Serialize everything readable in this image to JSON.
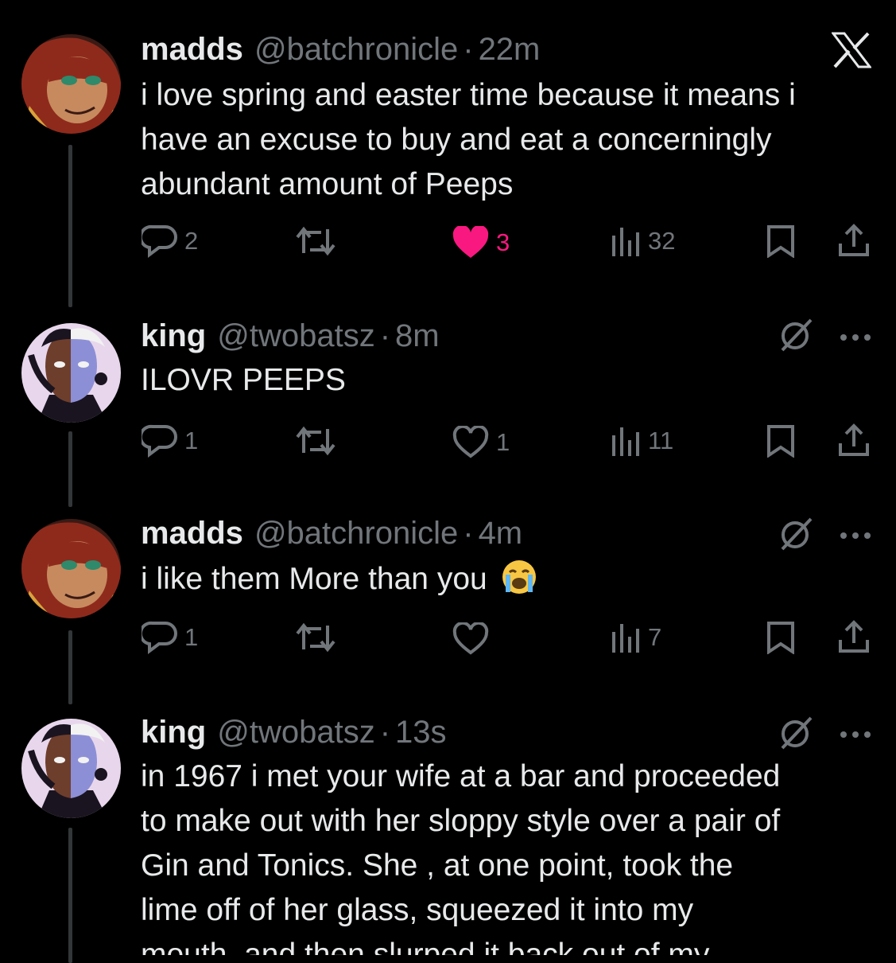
{
  "brand_logo": "X",
  "colors": {
    "background": "#000000",
    "text": "#e7e9ea",
    "muted": "#71767b",
    "like": "#f91880",
    "thread_line": "#333639"
  },
  "tweets": [
    {
      "name": "madds",
      "handle": "@batchronicle",
      "dot": "·",
      "time": "22m",
      "text_lines": [
        "i love spring and easter time because it means i",
        "have an excuse to buy and eat a concerningly",
        "abundant amount of Peeps"
      ],
      "replies": "2",
      "retweets": "",
      "likes": "3",
      "liked": true,
      "views": "32",
      "top_right_icon": "x-logo-icon"
    },
    {
      "name": "king",
      "handle": "@twobatsz",
      "dot": "·",
      "time": "8m",
      "text_lines": [
        "ILOVR PEEPS"
      ],
      "replies": "1",
      "retweets": "",
      "likes": "1",
      "liked": false,
      "views": "11",
      "top_right_icon": "grok-icon"
    },
    {
      "name": "madds",
      "handle": "@batchronicle",
      "dot": "·",
      "time": "4m",
      "text_lines": [
        "i like them More than you"
      ],
      "emoji": "loudly-crying-face-emoji",
      "replies": "1",
      "retweets": "",
      "likes": "",
      "liked": false,
      "views": "7",
      "top_right_icon": "grok-icon"
    },
    {
      "name": "king",
      "handle": "@twobatsz",
      "dot": "·",
      "time": "13s",
      "text_lines": [
        "in 1967 i met your wife at a bar and proceeded",
        "to make out with her sloppy style over a pair of",
        "Gin and Tonics. She , at one point, took the",
        "lime off of her glass, squeezed it into my",
        "mouth, and then slurped it back out of my"
      ],
      "top_right_icon": "grok-icon"
    }
  ]
}
